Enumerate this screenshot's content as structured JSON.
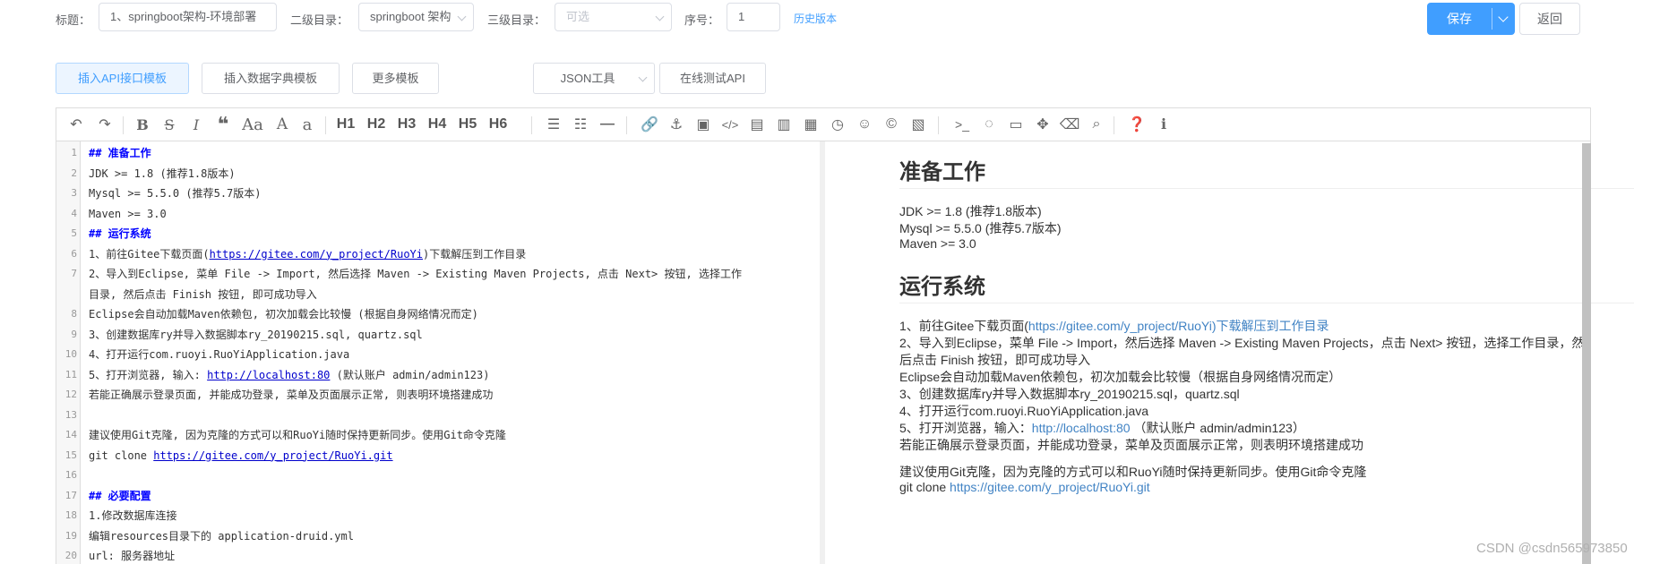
{
  "form": {
    "title_label": "标题：",
    "title_value": "1、springboot架构-环境部署",
    "level2_label": "二级目录：",
    "level2_value": "springboot 架构",
    "level3_label": "三级目录：",
    "level3_placeholder": "可选",
    "order_label": "序号：",
    "order_value": "1",
    "history_link": "历史版本",
    "save_label": "保存",
    "back_label": "返回"
  },
  "templates": {
    "api": "插入API接口模板",
    "dict": "插入数据字典模板",
    "more": "更多模板",
    "json": "JSON工具",
    "test": "在线测试API"
  },
  "toolbar": {
    "items": [
      "undo-icon",
      "redo-icon",
      "bold-icon",
      "strikethrough-icon",
      "italic-icon",
      "quote-icon",
      "uppercase-icon",
      "font-a-icon",
      "font-a-small-icon",
      "h1",
      "h2",
      "h3",
      "h4",
      "h5",
      "h6",
      "unordered-list-icon",
      "ordered-list-icon",
      "hr-icon",
      "link-icon",
      "anchor-icon",
      "image-icon",
      "code-icon",
      "code-block-icon",
      "code-file-icon",
      "table-icon",
      "datetime-icon",
      "emoji-icon",
      "copyright-icon",
      "pagebreak-icon",
      "terminal-icon",
      "preview-toggle-icon",
      "desktop-icon",
      "fullscreen-icon",
      "eraser-icon",
      "search-icon",
      "help-icon",
      "info-icon"
    ],
    "h1": "H1",
    "h2": "H2",
    "h3": "H3",
    "h4": "H4",
    "h5": "H5",
    "h6": "H6",
    "uppercase": "Aa",
    "font_a": "A",
    "font_a_small": "a"
  },
  "code": {
    "l1": "## 准备工作",
    "l2": "JDK >= 1.8 (推荐1.8版本)",
    "l3": "Mysql >= 5.5.0 (推荐5.7版本)",
    "l4": "Maven >= 3.0",
    "l5": "## 运行系统",
    "l6a": "1、前往Gitee下载页面(",
    "l6link": "https://gitee.com/y_project/RuoYi",
    "l6b": ")下载解压到工作目录",
    "l7a": "2、导入到Eclipse, 菜单 File -> Import, 然后选择 Maven -> Existing Maven Projects, 点击 Next> 按钮, 选择工作",
    "l7b": "目录, 然后点击 Finish 按钮, 即可成功导入",
    "l8": "Eclipse会自动加载Maven依赖包, 初次加载会比较慢 (根据自身网络情况而定)",
    "l9": "3、创建数据库ry并导入数据脚本ry_20190215.sql, quartz.sql",
    "l10": "4、打开运行com.ruoyi.RuoYiApplication.java",
    "l11a": "5、打开浏览器, 输入: ",
    "l11link": "http://localhost:80",
    "l11b": " (默认账户 admin/admin123)",
    "l12": "若能正确展示登录页面, 并能成功登录, 菜单及页面展示正常, 则表明环境搭建成功",
    "l14": "建议使用Git克隆, 因为克隆的方式可以和RuoYi随时保持更新同步。使用Git命令克隆",
    "l15a": "git clone ",
    "l15link": "https://gitee.com/y_project/RuoYi.git",
    "l17": "## 必要配置",
    "l18": "1.修改数据库连接",
    "l19": "编辑resources目录下的 application-druid.yml",
    "l20": "url: 服务器地址"
  },
  "line_numbers": [
    "1",
    "2",
    "3",
    "4",
    "5",
    "6",
    "7",
    "",
    "8",
    "9",
    "10",
    "11",
    "12",
    "13",
    "14",
    "15",
    "16",
    "17",
    "18",
    "19",
    "20"
  ],
  "preview": {
    "h_prepare": "准备工作",
    "p1": "JDK >= 1.8 (推荐1.8版本)",
    "p2": "Mysql >= 5.5.0 (推荐5.7版本)",
    "p3": "Maven >= 3.0",
    "h_run": "运行系统",
    "r1a": "1、前往Gitee下载页面(",
    "r1link": "https://gitee.com/y_project/RuoYi)下载解压到工作目录",
    "r2a": "2、导入到Eclipse，菜单 File -> Import，然后选择 Maven -> Existing Maven Projects，点击 Next> 按钮，选择工作目录，然",
    "r2b": "后点击 Finish 按钮，即可成功导入",
    "r3": "Eclipse会自动加载Maven依赖包，初次加载会比较慢（根据自身网络情况而定）",
    "r4": "3、创建数据库ry并导入数据脚本ry_20190215.sql，quartz.sql",
    "r5": "4、打开运行com.ruoyi.RuoYiApplication.java",
    "r6a": "5、打开浏览器，输入：",
    "r6link": "http://localhost:80",
    "r6b": " （默认账户 admin/admin123）",
    "r7": "若能正确展示登录页面，并能成功登录，菜单及页面展示正常，则表明环境搭建成功",
    "g1": "建议使用Git克隆，因为克隆的方式可以和RuoYi随时保持更新同步。使用Git命令克隆",
    "g2a": "git clone ",
    "g2link": "https://gitee.com/y_project/RuoYi.git"
  },
  "watermark": "CSDN @csdn565973850"
}
